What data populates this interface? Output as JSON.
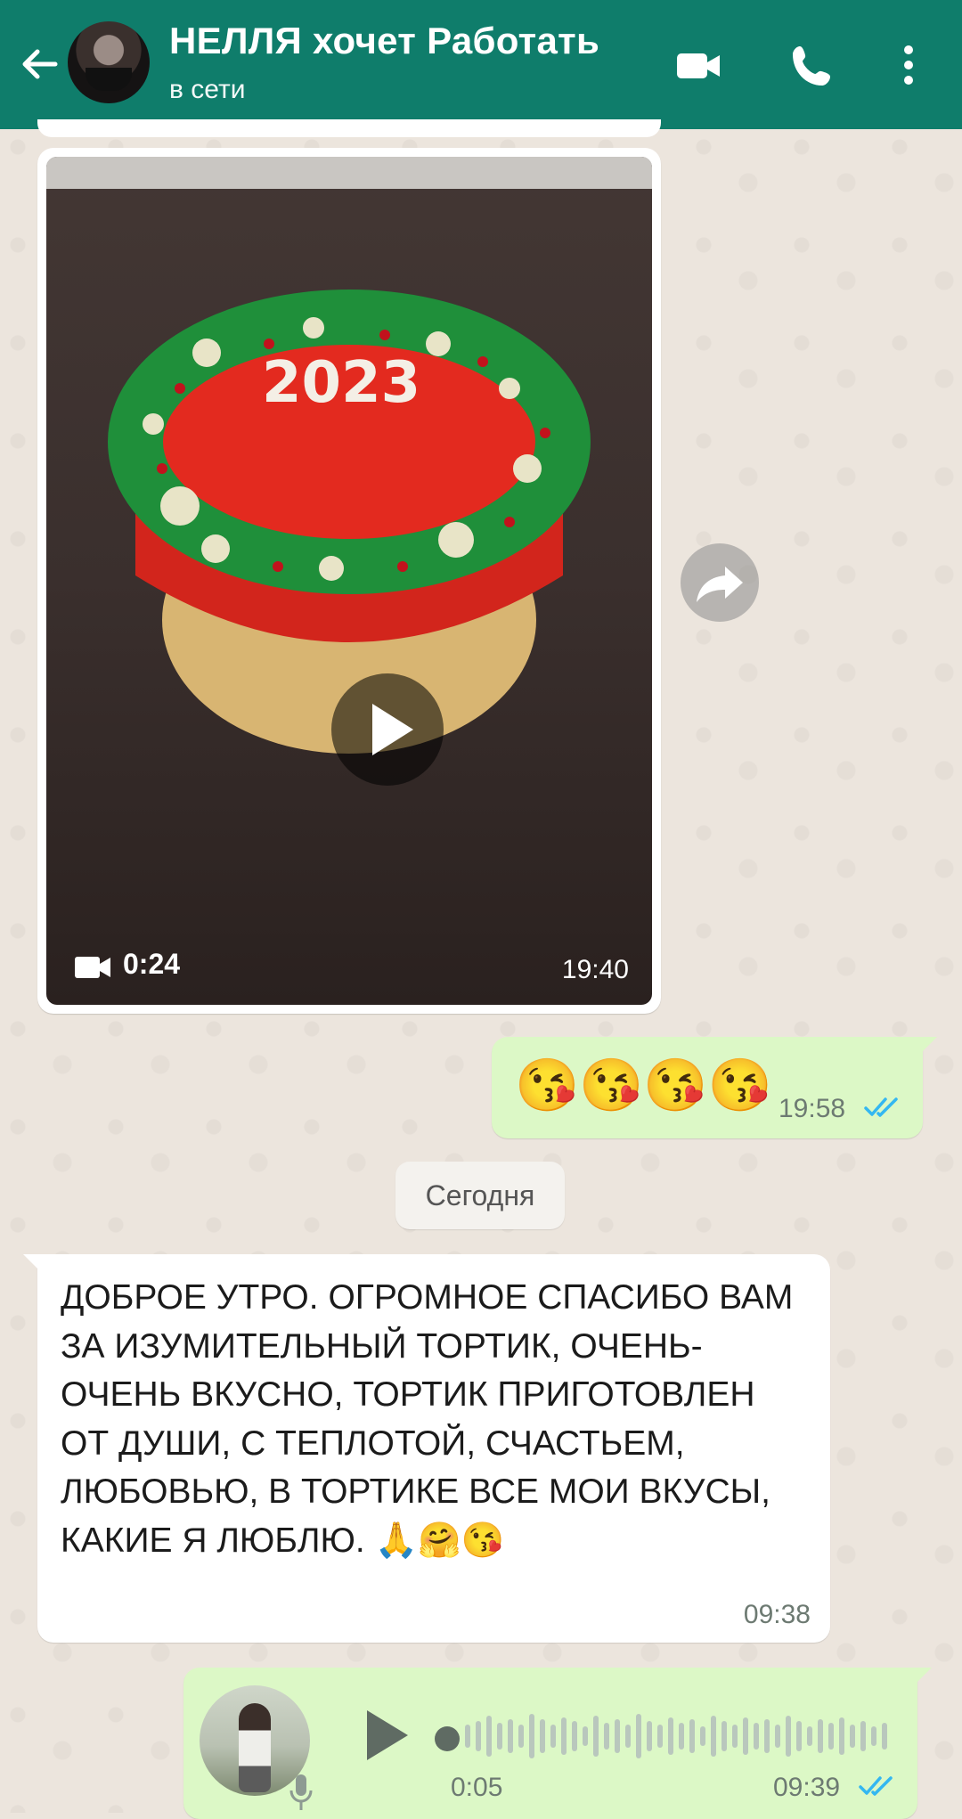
{
  "header": {
    "contact_name": "НЕЛЛЯ хочет Работать",
    "status": "в сети",
    "icons": [
      "back-arrow-icon",
      "video-call-icon",
      "phone-icon",
      "more-vert-icon"
    ],
    "color": "#0f7d6b"
  },
  "messages": {
    "video": {
      "duration": "0:24",
      "time": "19:40",
      "thumbnail_caption": "2023"
    },
    "emoji_out": {
      "text": "😘😘😘😘",
      "time": "19:58",
      "status": "read"
    },
    "date_chip": "Сегодня",
    "text_in": {
      "text": "ДОБРОЕ УТРО. ОГРОМНОЕ СПАСИБО ВАМ ЗА ИЗУМИТЕЛЬНЫЙ ТОРТИК, ОЧЕНЬ- ОЧЕНЬ ВКУСНО, ТОРТИК ПРИГОТОВЛЕН ОТ ДУШИ, С ТЕПЛОТОЙ, СЧАСТЬЕМ, ЛЮБОВЬЮ, В ТОРТИКЕ ВСЕ МОИ ВКУСЫ, КАКИЕ Я ЛЮБЛЮ. 🙏🤗😘",
      "time": "09:38"
    },
    "voice_out": {
      "duration": "0:05",
      "time": "09:39",
      "status": "read"
    }
  },
  "colors": {
    "outgoing_bubble": "#dcf8c6",
    "incoming_bubble": "#ffffff",
    "read_ticks": "#34b7f1"
  }
}
